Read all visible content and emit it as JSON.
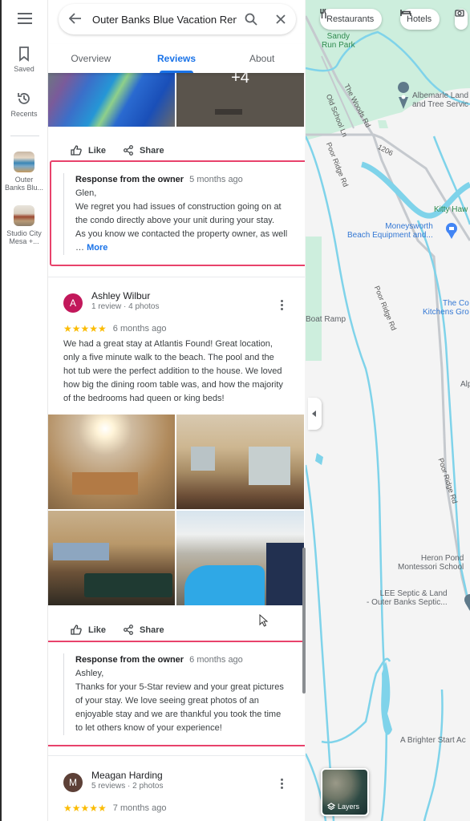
{
  "rail": {
    "saved_label": "Saved",
    "recents_label": "Recents",
    "recent_places": [
      {
        "label_line1": "Outer",
        "label_line2": "Banks Blu..."
      },
      {
        "label_line1": "Studio City",
        "label_line2": "Mesa +..."
      }
    ]
  },
  "search": {
    "value": "Outer Banks Blue Vacation Ren"
  },
  "tabs": [
    {
      "label": "Overview",
      "active": false
    },
    {
      "label": "Reviews",
      "active": true
    },
    {
      "label": "About",
      "active": false
    }
  ],
  "photos_top": {
    "more_count": "+4"
  },
  "actions": {
    "like": "Like",
    "share": "Share"
  },
  "reviews": [
    {
      "owner_response": {
        "heading": "Response from the owner",
        "time": "5 months ago",
        "lines": [
          "Glen,",
          "We regret you had issues of construction going on at",
          "the condo directly above your unit during your stay.",
          "As you know we contacted the property owner, as well"
        ],
        "ellipsis": "…",
        "more_label": "More"
      }
    },
    {
      "author": "Ashley Wilbur",
      "avatar_letter": "A",
      "avatar_color": "#c2185b",
      "meta": "1 review · 4 photos",
      "stars": 5,
      "stars_text": "★★★★★",
      "time": "6 months ago",
      "text_lines": [
        "We had a great stay at Atlantis Found! Great location,",
        "only a five minute walk to the beach. The pool and the",
        "hot tub were the perfect addition to the house. We loved",
        "how big the dining room table was, and how the majority",
        "of the bedrooms had queen or king beds!"
      ],
      "photos": [
        "kitchen",
        "living room",
        "dining room",
        "pool"
      ],
      "owner_response": {
        "heading": "Response from the owner",
        "time": "6 months ago",
        "lines": [
          "Ashley,",
          "Thanks for your 5-Star review and your great pictures",
          "of your stay.  We love seeing great photos of an",
          "enjoyable stay and we are thankful you took the time",
          "to let others know of your experience!"
        ]
      }
    },
    {
      "author": "Meagan Harding",
      "avatar_letter": "M",
      "avatar_color": "#5d4037",
      "meta": "5 reviews · 2 photos",
      "stars": 5,
      "stars_text": "★★★★★",
      "time": "7 months ago"
    }
  ],
  "map": {
    "chips": [
      {
        "label": "Restaurants",
        "icon": "restaurant-icon"
      },
      {
        "label": "Hotels",
        "icon": "hotel-icon"
      }
    ],
    "labels": {
      "park": [
        "Sandy",
        "Run Park"
      ],
      "albemarle": [
        "Albemarle Land",
        "and Tree Servic"
      ],
      "kitty": "Kitty Haw",
      "moneysworth": [
        "Moneysworth",
        "Beach Equipment and..."
      ],
      "the_co": [
        "The Co",
        "Kitchens Gro"
      ],
      "boat_ramp": "Boat Ramp",
      "alp": "Alp",
      "heron": [
        "Heron Pond",
        "Montessori School"
      ],
      "lee": [
        "LEE Septic & Land",
        "- Outer Banks Septic..."
      ],
      "brighter": "A Brighter Start Ac"
    },
    "roads": {
      "woods": "The Woods Rd",
      "old_school": "Old School Ln",
      "poor_ridge": "Poor Ridge Rd",
      "route": "1206"
    },
    "layers_label": "Layers"
  }
}
